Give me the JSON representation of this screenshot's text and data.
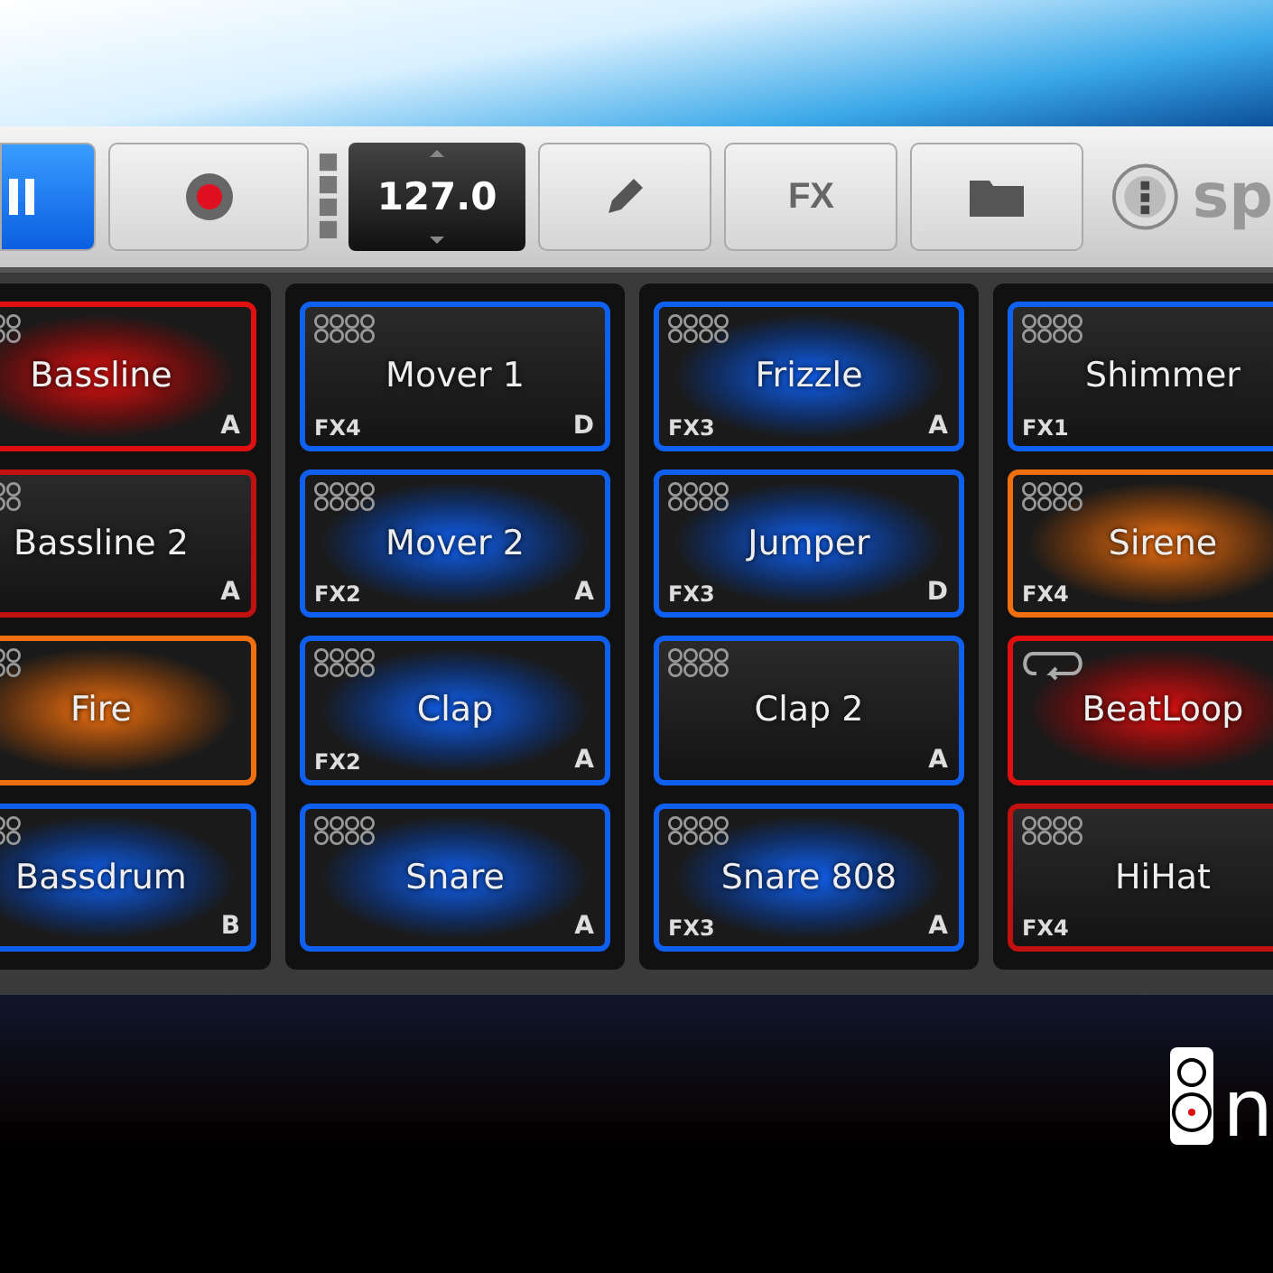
{
  "toolbar": {
    "play_active": true,
    "tempo": "127.0",
    "fx_label": "FX",
    "brand": "sp"
  },
  "columns": [
    {
      "pads": [
        {
          "name": "Bassline",
          "slot": "A",
          "color": "#e01010",
          "playing": true,
          "kind": "pattern"
        },
        {
          "name": "Bassline 2",
          "slot": "A",
          "color": "#c01010",
          "playing": false,
          "kind": "pattern"
        },
        {
          "name": "Fire",
          "color": "#f07010",
          "playing": true,
          "kind": "pattern"
        },
        {
          "name": "Bassdrum",
          "slot": "B",
          "color": "#1060f0",
          "playing": true,
          "kind": "pattern"
        }
      ]
    },
    {
      "pads": [
        {
          "name": "Mover 1",
          "fx": "FX4",
          "slot": "D",
          "color": "#1060f0",
          "playing": false,
          "kind": "pattern"
        },
        {
          "name": "Mover 2",
          "fx": "FX2",
          "slot": "A",
          "color": "#1060f0",
          "playing": true,
          "kind": "pattern"
        },
        {
          "name": "Clap",
          "fx": "FX2",
          "slot": "A",
          "color": "#1060f0",
          "playing": true,
          "kind": "pattern"
        },
        {
          "name": "Snare",
          "slot": "A",
          "color": "#1060f0",
          "playing": true,
          "kind": "pattern"
        }
      ]
    },
    {
      "pads": [
        {
          "name": "Frizzle",
          "fx": "FX3",
          "slot": "A",
          "color": "#1060f0",
          "playing": true,
          "kind": "pattern"
        },
        {
          "name": "Jumper",
          "fx": "FX3",
          "slot": "D",
          "color": "#1060f0",
          "playing": true,
          "kind": "pattern"
        },
        {
          "name": "Clap 2",
          "slot": "A",
          "color": "#1060f0",
          "playing": false,
          "kind": "pattern"
        },
        {
          "name": "Snare 808",
          "fx": "FX3",
          "slot": "A",
          "color": "#1060f0",
          "playing": true,
          "kind": "pattern"
        }
      ]
    },
    {
      "pads": [
        {
          "name": "Shimmer",
          "fx": "FX1",
          "color": "#1060f0",
          "playing": false,
          "kind": "pattern"
        },
        {
          "name": "Sirene",
          "fx": "FX4",
          "color": "#f07010",
          "playing": true,
          "kind": "pattern"
        },
        {
          "name": "BeatLoop",
          "color": "#e01010",
          "playing": true,
          "kind": "loop"
        },
        {
          "name": "HiHat",
          "fx": "FX4",
          "color": "#c01010",
          "playing": false,
          "kind": "pattern"
        }
      ]
    }
  ],
  "logo": {
    "text": "n"
  }
}
